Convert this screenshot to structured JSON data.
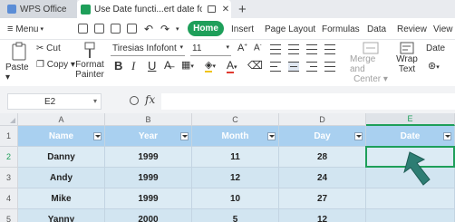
{
  "titlebar": {
    "app_tab": "WPS Office",
    "doc_tab": "Use Date functi...ert date format",
    "new_tab": "+"
  },
  "menu": {
    "menu_label": "Menu",
    "tabs": [
      "Home",
      "Insert",
      "Page Layout",
      "Formulas",
      "Data",
      "Review",
      "View"
    ]
  },
  "ribbon": {
    "cut": "Cut",
    "paste": "Paste",
    "copy": "Copy",
    "format_painter_1": "Format",
    "format_painter_2": "Painter",
    "font_name": "Tiresias Infofont",
    "font_size": "11",
    "bold": "B",
    "italic": "I",
    "underline": "U",
    "merge_1": "Merge and",
    "merge_2": "Center",
    "wrap_1": "Wrap",
    "wrap_2": "Text",
    "date_label": "Date"
  },
  "formula_bar": {
    "cell_ref": "E2",
    "fx": "fx",
    "value": ""
  },
  "grid": {
    "columns": [
      "A",
      "B",
      "C",
      "D",
      "E"
    ],
    "rows": [
      "1",
      "2",
      "3",
      "4",
      "5"
    ],
    "headers": [
      "Name",
      "Year",
      "Month",
      "Day",
      "Date"
    ],
    "data": [
      [
        "Danny",
        "1999",
        "11",
        "28",
        ""
      ],
      [
        "Andy",
        "1999",
        "12",
        "24",
        ""
      ],
      [
        "Mike",
        "1999",
        "10",
        "27",
        ""
      ],
      [
        "Yanny",
        "2000",
        "5",
        "12",
        ""
      ]
    ]
  },
  "colors": {
    "accent": "#1e9f5a",
    "header_fill": "#a9d0f0",
    "row_fill": "#dcebf4"
  }
}
